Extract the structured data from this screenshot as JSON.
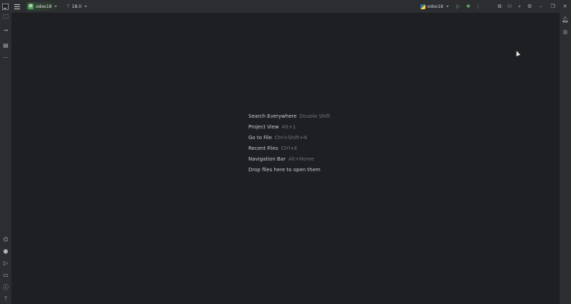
{
  "titlebar": {
    "project_badge": "O",
    "project_name": "odoo18",
    "branch": "18.0",
    "run_config": "odoo18"
  },
  "icons": {
    "main_menu": "hamburger-icon",
    "run": "play-icon",
    "debug": "bug-icon",
    "more": "more-vertical-icon",
    "code_with_me": "code-with-me-icon",
    "account": "user-icon",
    "search": "search-icon",
    "settings": "gear-icon",
    "minimize": "minimize-icon",
    "restore": "restore-icon",
    "close": "close-icon"
  },
  "left_strip_top": [
    "project-icon",
    "commit-icon",
    "structure-icon",
    "more-tools-icon"
  ],
  "left_strip_bottom": [
    "python-packages-icon",
    "services-icon",
    "run-tool-icon",
    "terminal-icon",
    "problems-icon",
    "git-icon"
  ],
  "right_strip": [
    "notifications-icon",
    "ai-assistant-icon"
  ],
  "empty_editor": {
    "hints": [
      {
        "label": "Search Everywhere",
        "shortcut": "Double Shift"
      },
      {
        "label": "Project View",
        "shortcut": "Alt+1"
      },
      {
        "label": "Go to File",
        "shortcut": "Ctrl+Shift+N"
      },
      {
        "label": "Recent Files",
        "shortcut": "Ctrl+E"
      },
      {
        "label": "Navigation Bar",
        "shortcut": "Alt+Home"
      }
    ],
    "drop_text": "Drop files here to open them"
  },
  "colors": {
    "editor_bg": "#1e1f22",
    "chrome_bg": "#2b2d30",
    "project_badge": "#5a9b5e",
    "run_green": "#5fb865"
  }
}
